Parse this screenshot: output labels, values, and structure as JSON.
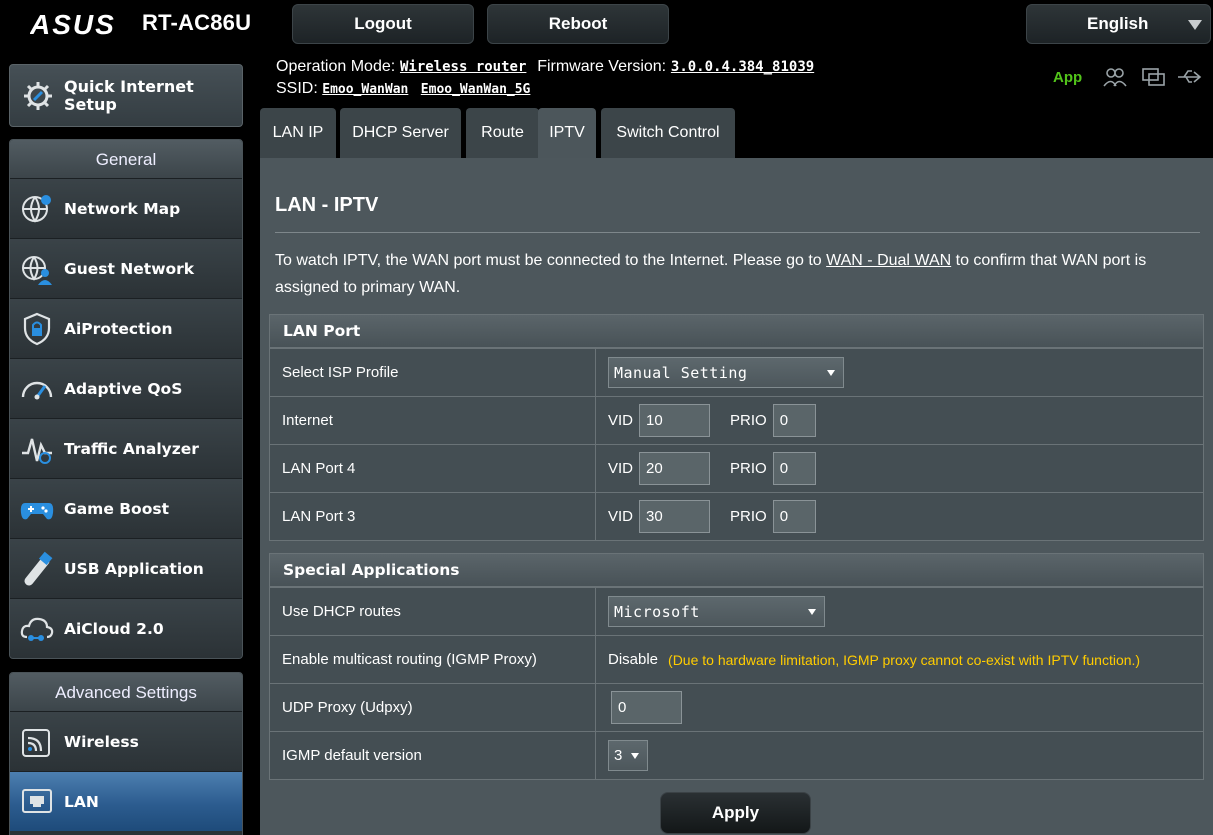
{
  "header": {
    "brand": "ASUS",
    "model": "RT-AC86U",
    "logout_label": "Logout",
    "reboot_label": "Reboot",
    "language": "English",
    "op_mode_label": "Operation Mode:",
    "op_mode_value": "Wireless router",
    "firmware_label": "Firmware Version:",
    "firmware_value": "3.0.0.4.384_81039",
    "ssid_label": "SSID:",
    "ssid_1": "Emoo_WanWan",
    "ssid_2": "Emoo_WanWan_5G",
    "app_label": "App",
    "app_color": "#52c41a"
  },
  "sidebar": {
    "qis_label_1": "Quick Internet",
    "qis_label_2": "Setup",
    "general_title": "General",
    "general_items": [
      {
        "label": "Network Map",
        "icon": "network-map-icon"
      },
      {
        "label": "Guest Network",
        "icon": "guest-network-icon"
      },
      {
        "label": "AiProtection",
        "icon": "shield-icon"
      },
      {
        "label": "Adaptive QoS",
        "icon": "speedometer-icon"
      },
      {
        "label": "Traffic Analyzer",
        "icon": "traffic-analyzer-icon"
      },
      {
        "label": "Game Boost",
        "icon": "gamepad-icon"
      },
      {
        "label": "USB Application",
        "icon": "usb-icon"
      },
      {
        "label": "AiCloud 2.0",
        "icon": "cloud-icon"
      }
    ],
    "advanced_title": "Advanced Settings",
    "advanced_items": [
      {
        "label": "Wireless",
        "icon": "wireless-icon"
      },
      {
        "label": "LAN",
        "icon": "lan-icon",
        "active": true
      }
    ]
  },
  "tabs": [
    "LAN IP",
    "DHCP Server",
    "Route",
    "IPTV",
    "Switch Control"
  ],
  "active_tab": "IPTV",
  "main": {
    "title": "LAN - IPTV",
    "desc_1": "To watch IPTV, the WAN port must be connected to the Internet. Please go to ",
    "desc_link": "WAN - Dual WAN",
    "desc_2": " to confirm that WAN port is assigned to primary WAN.",
    "lan_port": {
      "header": "LAN Port",
      "isp_label": "Select ISP Profile",
      "isp_value": "Manual Setting",
      "vid_label": "VID",
      "prio_label": "PRIO",
      "rows": [
        {
          "label": "Internet",
          "vid": "10",
          "prio": "0"
        },
        {
          "label": "LAN Port 4",
          "vid": "20",
          "prio": "0"
        },
        {
          "label": "LAN Port 3",
          "vid": "30",
          "prio": "0"
        }
      ]
    },
    "special": {
      "header": "Special Applications",
      "dhcp_label": "Use DHCP routes",
      "dhcp_value": "Microsoft",
      "igmp_label": "Enable multicast routing (IGMP Proxy)",
      "igmp_value": "Disable",
      "igmp_warning": "(Due to hardware limitation, IGMP proxy cannot co-exist with IPTV function.)",
      "warning_color": "#ffcc00",
      "udpxy_label": "UDP Proxy (Udpxy)",
      "udpxy_value": "0",
      "igmp_ver_label": "IGMP default version",
      "igmp_ver_value": "3"
    },
    "apply_label": "Apply"
  }
}
